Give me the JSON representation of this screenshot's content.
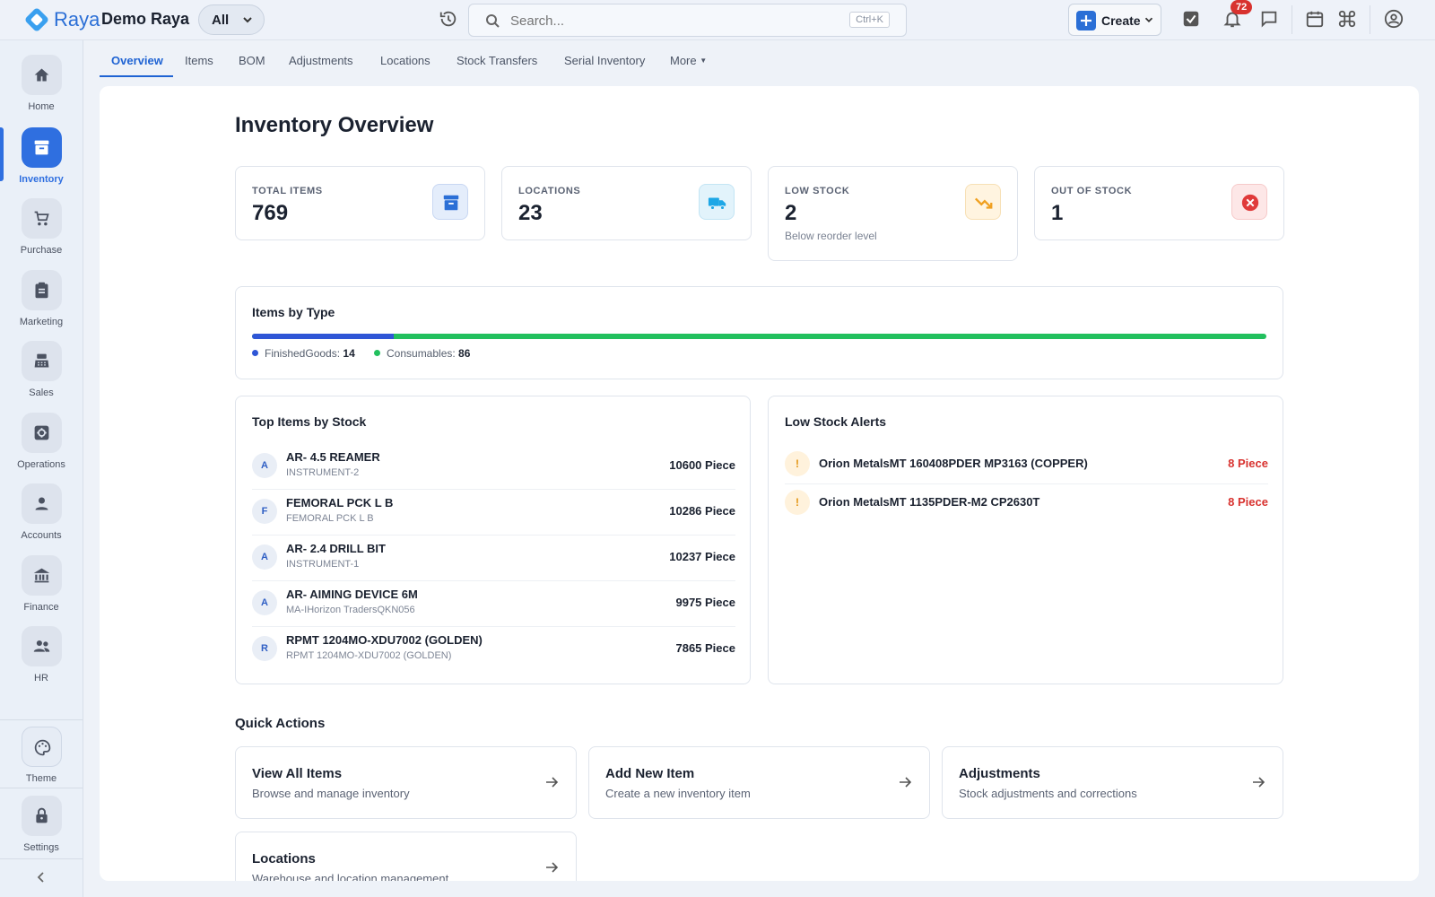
{
  "header": {
    "brand": "Raya",
    "org_name": "Demo Raya",
    "scope": "All",
    "search_placeholder": "Search...",
    "search_shortcut": "Ctrl+K",
    "create_label": "Create",
    "notification_count": "72"
  },
  "sidebar": {
    "items": [
      {
        "label": "Home",
        "icon": "home-icon"
      },
      {
        "label": "Inventory",
        "icon": "inventory-icon"
      },
      {
        "label": "Purchase",
        "icon": "cart-icon"
      },
      {
        "label": "Marketing",
        "icon": "clipboard-icon"
      },
      {
        "label": "Sales",
        "icon": "register-icon"
      },
      {
        "label": "Operations",
        "icon": "gear-icon"
      },
      {
        "label": "Accounts",
        "icon": "person-icon"
      },
      {
        "label": "Finance",
        "icon": "bank-icon"
      },
      {
        "label": "HR",
        "icon": "people-icon"
      }
    ],
    "theme_label": "Theme",
    "settings_label": "Settings"
  },
  "tabs": [
    "Overview",
    "Items",
    "BOM",
    "Adjustments",
    "Locations",
    "Stock Transfers",
    "Serial Inventory",
    "More"
  ],
  "page": {
    "title": "Inventory Overview"
  },
  "stats": [
    {
      "label": "TOTAL ITEMS",
      "value": "769",
      "sub": "",
      "icon": "archive-icon",
      "color": "#2b6fd6"
    },
    {
      "label": "LOCATIONS",
      "value": "23",
      "sub": "",
      "icon": "truck-icon",
      "color": "#1ea7e6"
    },
    {
      "label": "LOW STOCK",
      "value": "2",
      "sub": "Below reorder level",
      "icon": "trending-down-icon",
      "color": "#f0a020"
    },
    {
      "label": "OUT OF STOCK",
      "value": "1",
      "sub": "",
      "icon": "x-circle-icon",
      "color": "#e03a3a"
    }
  ],
  "items_by_type": {
    "title": "Items by Type",
    "segments": [
      {
        "name": "FinishedGoods",
        "value": 14,
        "color": "#2f56d6"
      },
      {
        "name": "Consumables",
        "value": 86,
        "color": "#22c05e"
      }
    ]
  },
  "top_items": {
    "title": "Top Items by Stock",
    "rows": [
      {
        "initial": "A",
        "name": "AR- 4.5 REAMER",
        "sub": "INSTRUMENT-2",
        "qty": "10600 Piece"
      },
      {
        "initial": "F",
        "name": "FEMORAL PCK L B",
        "sub": "FEMORAL PCK L B",
        "qty": "10286 Piece"
      },
      {
        "initial": "A",
        "name": "AR- 2.4 DRILL BIT",
        "sub": "INSTRUMENT-1",
        "qty": "10237 Piece"
      },
      {
        "initial": "A",
        "name": "AR- AIMING DEVICE 6M",
        "sub": "MA-IHorizon TradersQKN056",
        "qty": "9975 Piece"
      },
      {
        "initial": "R",
        "name": "RPMT 1204MO-XDU7002 (GOLDEN)",
        "sub": "RPMT 1204MO-XDU7002 (GOLDEN)",
        "qty": "7865 Piece"
      }
    ]
  },
  "low_stock": {
    "title": "Low Stock Alerts",
    "mark": "!",
    "rows": [
      {
        "name": "Orion MetalsMT 160408PDER MP3163 (COPPER)",
        "qty": "8 Piece"
      },
      {
        "name": "Orion MetalsMT 1135PDER-M2 CP2630T",
        "qty": "8 Piece"
      }
    ]
  },
  "quick_actions": {
    "title": "Quick Actions",
    "items": [
      {
        "title": "View All Items",
        "desc": "Browse and manage inventory"
      },
      {
        "title": "Add New Item",
        "desc": "Create a new inventory item"
      },
      {
        "title": "Adjustments",
        "desc": "Stock adjustments and corrections"
      },
      {
        "title": "Locations",
        "desc": "Warehouse and location management"
      }
    ]
  }
}
